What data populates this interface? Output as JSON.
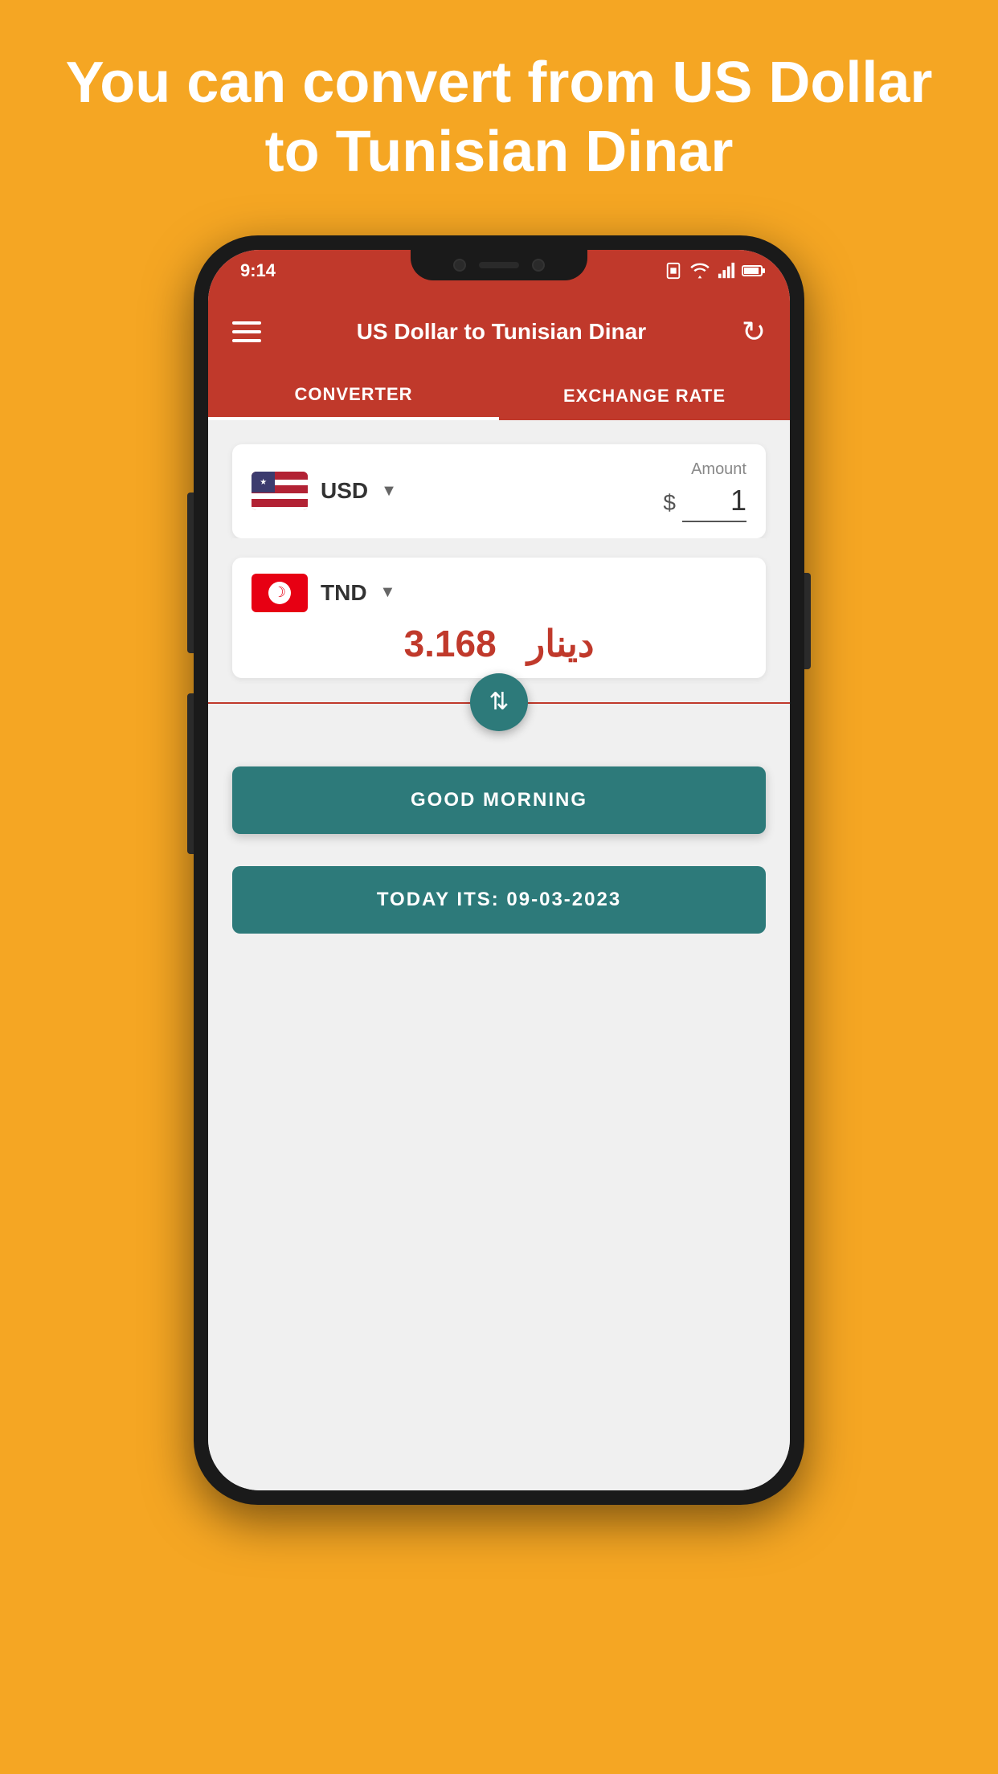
{
  "hero": {
    "text": "You can convert from US Dollar to Tunisian Dinar"
  },
  "status_bar": {
    "time": "9:14",
    "wifi": true,
    "signal": true,
    "battery": true
  },
  "app_bar": {
    "title": "US Dollar to Tunisian Dinar",
    "menu_icon": "menu-icon",
    "refresh_icon": "refresh-icon"
  },
  "tabs": [
    {
      "label": "CONVERTER",
      "active": true
    },
    {
      "label": "EXCHANGE RATE",
      "active": false
    }
  ],
  "converter": {
    "from_currency": {
      "code": "USD",
      "flag": "us",
      "amount_label": "Amount",
      "symbol": "$",
      "value": "1"
    },
    "to_currency": {
      "code": "TND",
      "flag": "tn",
      "result_value": "3.168",
      "result_unit": "دينار"
    },
    "swap_button_label": "↕"
  },
  "buttons": {
    "good_morning": "GOOD MORNING",
    "today": "TODAY ITS: 09-03-2023"
  }
}
